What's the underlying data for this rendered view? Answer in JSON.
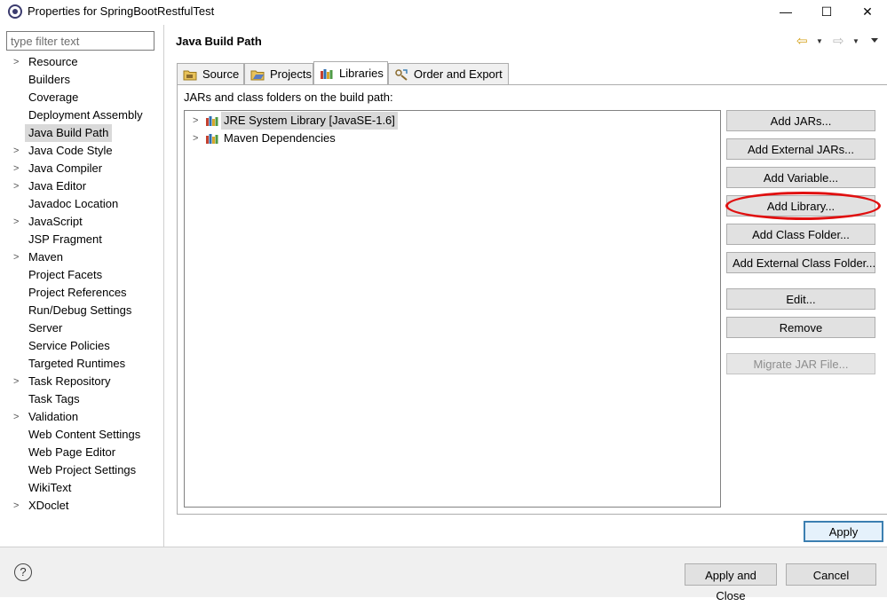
{
  "window": {
    "title": "Properties for SpringBootRestfulTest",
    "minimize_glyph": "—",
    "maximize_glyph": "☐",
    "close_glyph": "✕",
    "app_icon": "eclipse-icon"
  },
  "filter": {
    "placeholder": "type filter text"
  },
  "nav": {
    "items": [
      {
        "label": "Resource",
        "expandable": true
      },
      {
        "label": "Builders",
        "expandable": false
      },
      {
        "label": "Coverage",
        "expandable": false
      },
      {
        "label": "Deployment Assembly",
        "expandable": false
      },
      {
        "label": "Java Build Path",
        "expandable": false,
        "selected": true
      },
      {
        "label": "Java Code Style",
        "expandable": true
      },
      {
        "label": "Java Compiler",
        "expandable": true
      },
      {
        "label": "Java Editor",
        "expandable": true
      },
      {
        "label": "Javadoc Location",
        "expandable": false
      },
      {
        "label": "JavaScript",
        "expandable": true
      },
      {
        "label": "JSP Fragment",
        "expandable": false
      },
      {
        "label": "Maven",
        "expandable": true
      },
      {
        "label": "Project Facets",
        "expandable": false
      },
      {
        "label": "Project References",
        "expandable": false
      },
      {
        "label": "Run/Debug Settings",
        "expandable": false
      },
      {
        "label": "Server",
        "expandable": false
      },
      {
        "label": "Service Policies",
        "expandable": false
      },
      {
        "label": "Targeted Runtimes",
        "expandable": false
      },
      {
        "label": "Task Repository",
        "expandable": true
      },
      {
        "label": "Task Tags",
        "expandable": false
      },
      {
        "label": "Validation",
        "expandable": true
      },
      {
        "label": "Web Content Settings",
        "expandable": false
      },
      {
        "label": "Web Page Editor",
        "expandable": false
      },
      {
        "label": "Web Project Settings",
        "expandable": false
      },
      {
        "label": "WikiText",
        "expandable": false
      },
      {
        "label": "XDoclet",
        "expandable": true
      }
    ]
  },
  "page": {
    "title": "Java Build Path",
    "back_glyph": "⇦",
    "forward_glyph": "⇨",
    "menu_glyph": "▼"
  },
  "tabs": [
    {
      "label": "Source",
      "icon": "source-folder-icon"
    },
    {
      "label": "Projects",
      "icon": "projects-folder-icon"
    },
    {
      "label": "Libraries",
      "icon": "libraries-icon",
      "active": true
    },
    {
      "label": "Order and Export",
      "icon": "order-export-icon"
    }
  ],
  "libraries": {
    "label": "JARs and class folders on the build path:",
    "entries": [
      {
        "label": "JRE System Library [JavaSE-1.6]",
        "selected": true
      },
      {
        "label": "Maven Dependencies",
        "selected": false
      }
    ]
  },
  "buttons": {
    "add_jars": "Add JARs...",
    "add_external_jars": "Add External JARs...",
    "add_variable": "Add Variable...",
    "add_library": "Add Library...",
    "add_class_folder": "Add Class Folder...",
    "add_external_class_folder": "Add External Class Folder...",
    "edit": "Edit...",
    "remove": "Remove",
    "migrate_jar": "Migrate JAR File...",
    "apply": "Apply",
    "apply_and_close": "Apply and Close",
    "cancel": "Cancel",
    "help_glyph": "?"
  },
  "colors": {
    "highlight_ring": "#e01010",
    "selection": "#d9d9d9",
    "default_button_border": "#3c7fb1"
  }
}
